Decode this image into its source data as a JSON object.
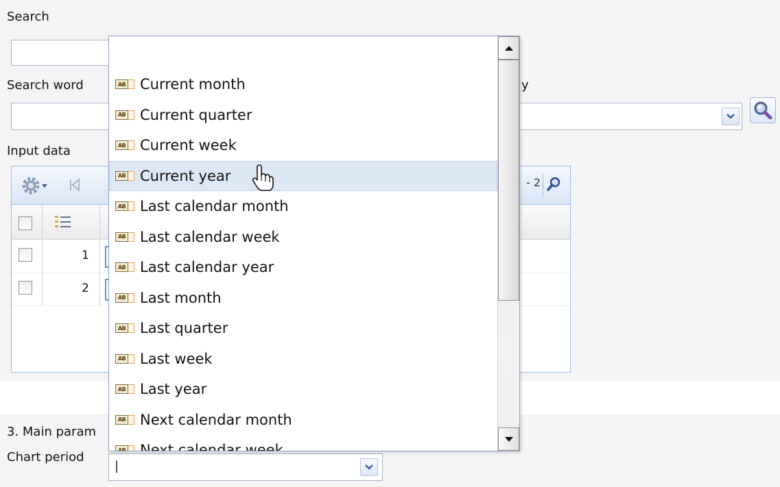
{
  "form": {
    "search_label": "Search",
    "search_word_label": "Search word",
    "hidden_label_fragment": "y",
    "input_data_label": "Input data",
    "section_label": "3. Main param",
    "chart_period_label": "Chart period",
    "chart_period_value": "|"
  },
  "grid": {
    "pager_fragment": "- 2",
    "rows": [
      {
        "number": "1"
      },
      {
        "number": "2"
      }
    ]
  },
  "dropdown": {
    "hovered_index": 3,
    "items": [
      "Current month",
      "Current quarter",
      "Current week",
      "Current year",
      "Last calendar month",
      "Last calendar week",
      "Last calendar year",
      "Last month",
      "Last quarter",
      "Last week",
      "Last year",
      "Next calendar month",
      "Next calendar week"
    ]
  },
  "colors": {
    "accent_border": "#99bbe8",
    "hover_bg": "#dde8f6",
    "panel_bg": "#f4f4f4"
  }
}
